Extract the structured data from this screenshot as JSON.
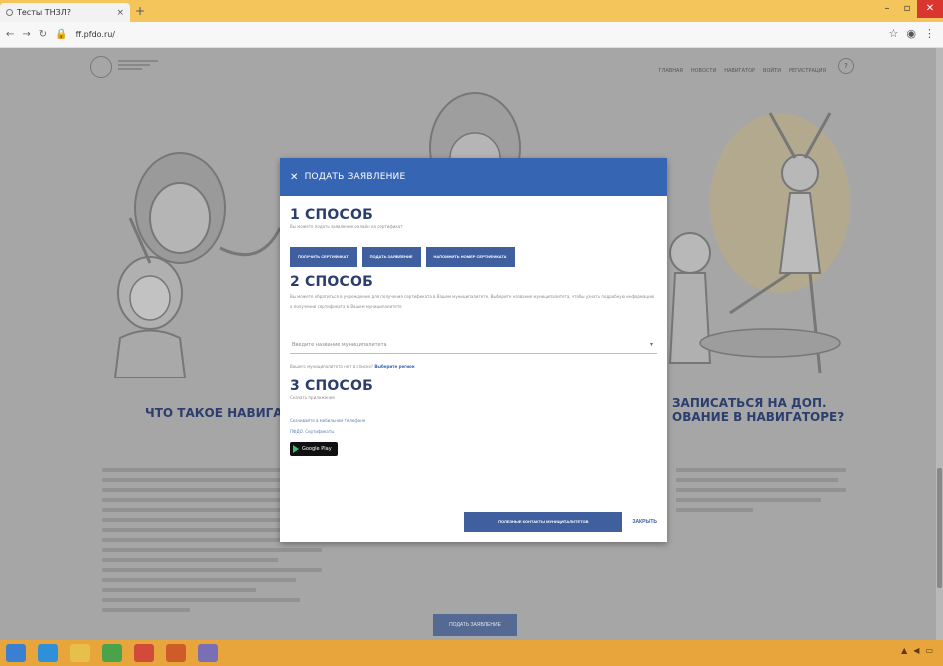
{
  "browser": {
    "tab_title": "Тесты ТНЗЛ?",
    "tab_close": "×",
    "new_tab": "+",
    "address": "ff.pfdo.ru/",
    "window_buttons": [
      "–",
      "▫",
      "✕"
    ]
  },
  "site": {
    "nav_items": [
      "ГЛАВНАЯ",
      "НОВОСТИ",
      "НАВИГАТОР",
      "ВОЙТИ",
      "РЕГИСТРАЦИЯ"
    ],
    "help_label": "?",
    "left_title": "ЧТО ТАКОЕ НАВИГАТО",
    "right_title_line1": "ЗАПИСАТЬСЯ НА ДОП.",
    "right_title_line2": "ОВАНИЕ В НАВИГАТОРЕ?",
    "apply_button": "ПОДАТЬ ЗАЯВЛЕНИЕ"
  },
  "modal": {
    "header": "ПОДАТЬ ЗАЯВЛЕНИЕ",
    "close_x": "✕",
    "way1": {
      "title": "1 СПОСОБ",
      "subtitle": "Вы можете подать заявление онлайн на сертификат",
      "buttons": [
        "ПОЛУЧИТЬ СЕРТИФИКАТ",
        "ПОДАТЬ ЗАЯВЛЕНИЕ",
        "НАПОМНИТЬ НОМЕР СЕРТИФИКАТА"
      ]
    },
    "way2": {
      "title": "2 СПОСОБ",
      "description": "Вы можете обратиться в учреждение для получения сертификата в Вашем муниципалитете. Выберите название муниципалитета, чтобы узнать подробную информацию о получении сертификата в Вашем муниципалитете",
      "select_placeholder": "Введите название муниципалитета",
      "region_prefix": "Вашего муниципалитета нет в списке?",
      "region_link": "Выберите регион"
    },
    "way3": {
      "title": "3 СПОСОБ",
      "subtitle": "Скачать приложение",
      "store_label": "Скачивайте в мобильном телефоне",
      "store_label2": "ПФДО. Сертификаты",
      "gplay": "Google Play"
    },
    "footer": {
      "contacts_button": "ПОЛЕЗНЫЕ КОНТАКТЫ МУНИЦИПАЛИТЕТОВ",
      "close_button": "ЗАКРЫТЬ"
    }
  },
  "colors": {
    "modal_header": "#3666b3",
    "button_blue": "#3f5f9f",
    "title_navy": "#2c3e6d",
    "taskbar": "#e8a53c",
    "titlebar": "#f4c55a"
  }
}
